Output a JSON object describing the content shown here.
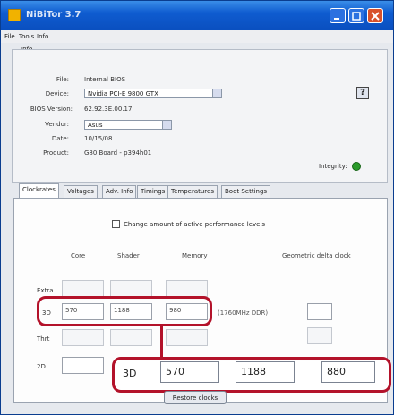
{
  "window": {
    "title": "NiBiTor 3.7"
  },
  "menu": [
    "File",
    "Tools",
    "Info"
  ],
  "info": {
    "section_label": "Info",
    "file_label": "File:",
    "file_value": "Internal BIOS",
    "device_label": "Device:",
    "device_value": "Nvidia PCI-E 9800 GTX",
    "bios_version_label": "BIOS Version:",
    "bios_version_value": "62.92.3E.00.17",
    "vendor_label": "Vendor:",
    "vendor_value": "Asus",
    "date_label": "Date:",
    "date_value": "10/15/08",
    "product_label": "Product:",
    "product_value": "G80 Board - p394h01",
    "integrity_label": "Integrity:",
    "help_label": "?"
  },
  "tabs": [
    "Clockrates",
    "Voltages",
    "Adv. Info",
    "Timings",
    "Temperatures",
    "Boot Settings"
  ],
  "clocks": {
    "change_label": "Change amount of active performance levels",
    "headers": {
      "core": "Core",
      "shader": "Shader",
      "memory": "Memory",
      "geometric": "Geometric delta clock"
    },
    "rows": [
      {
        "label": "Extra",
        "core": "",
        "shader": "",
        "memory": ""
      },
      {
        "label": "3D",
        "core": "570",
        "shader": "1188",
        "memory": "980",
        "note": "(1760MHz DDR)"
      },
      {
        "label": "Thrt",
        "core": "",
        "shader": "",
        "memory": ""
      },
      {
        "label": "2D",
        "core": "",
        "shader": "",
        "memory": ""
      }
    ],
    "zoom": {
      "label": "3D",
      "core": "570",
      "shader": "1188",
      "memory": "880"
    },
    "button_label": "Restore clocks"
  },
  "colors": {
    "title_bar": "#0f5cd0",
    "highlight": "#b3122a",
    "integrity_ok": "#2b9a2b"
  }
}
